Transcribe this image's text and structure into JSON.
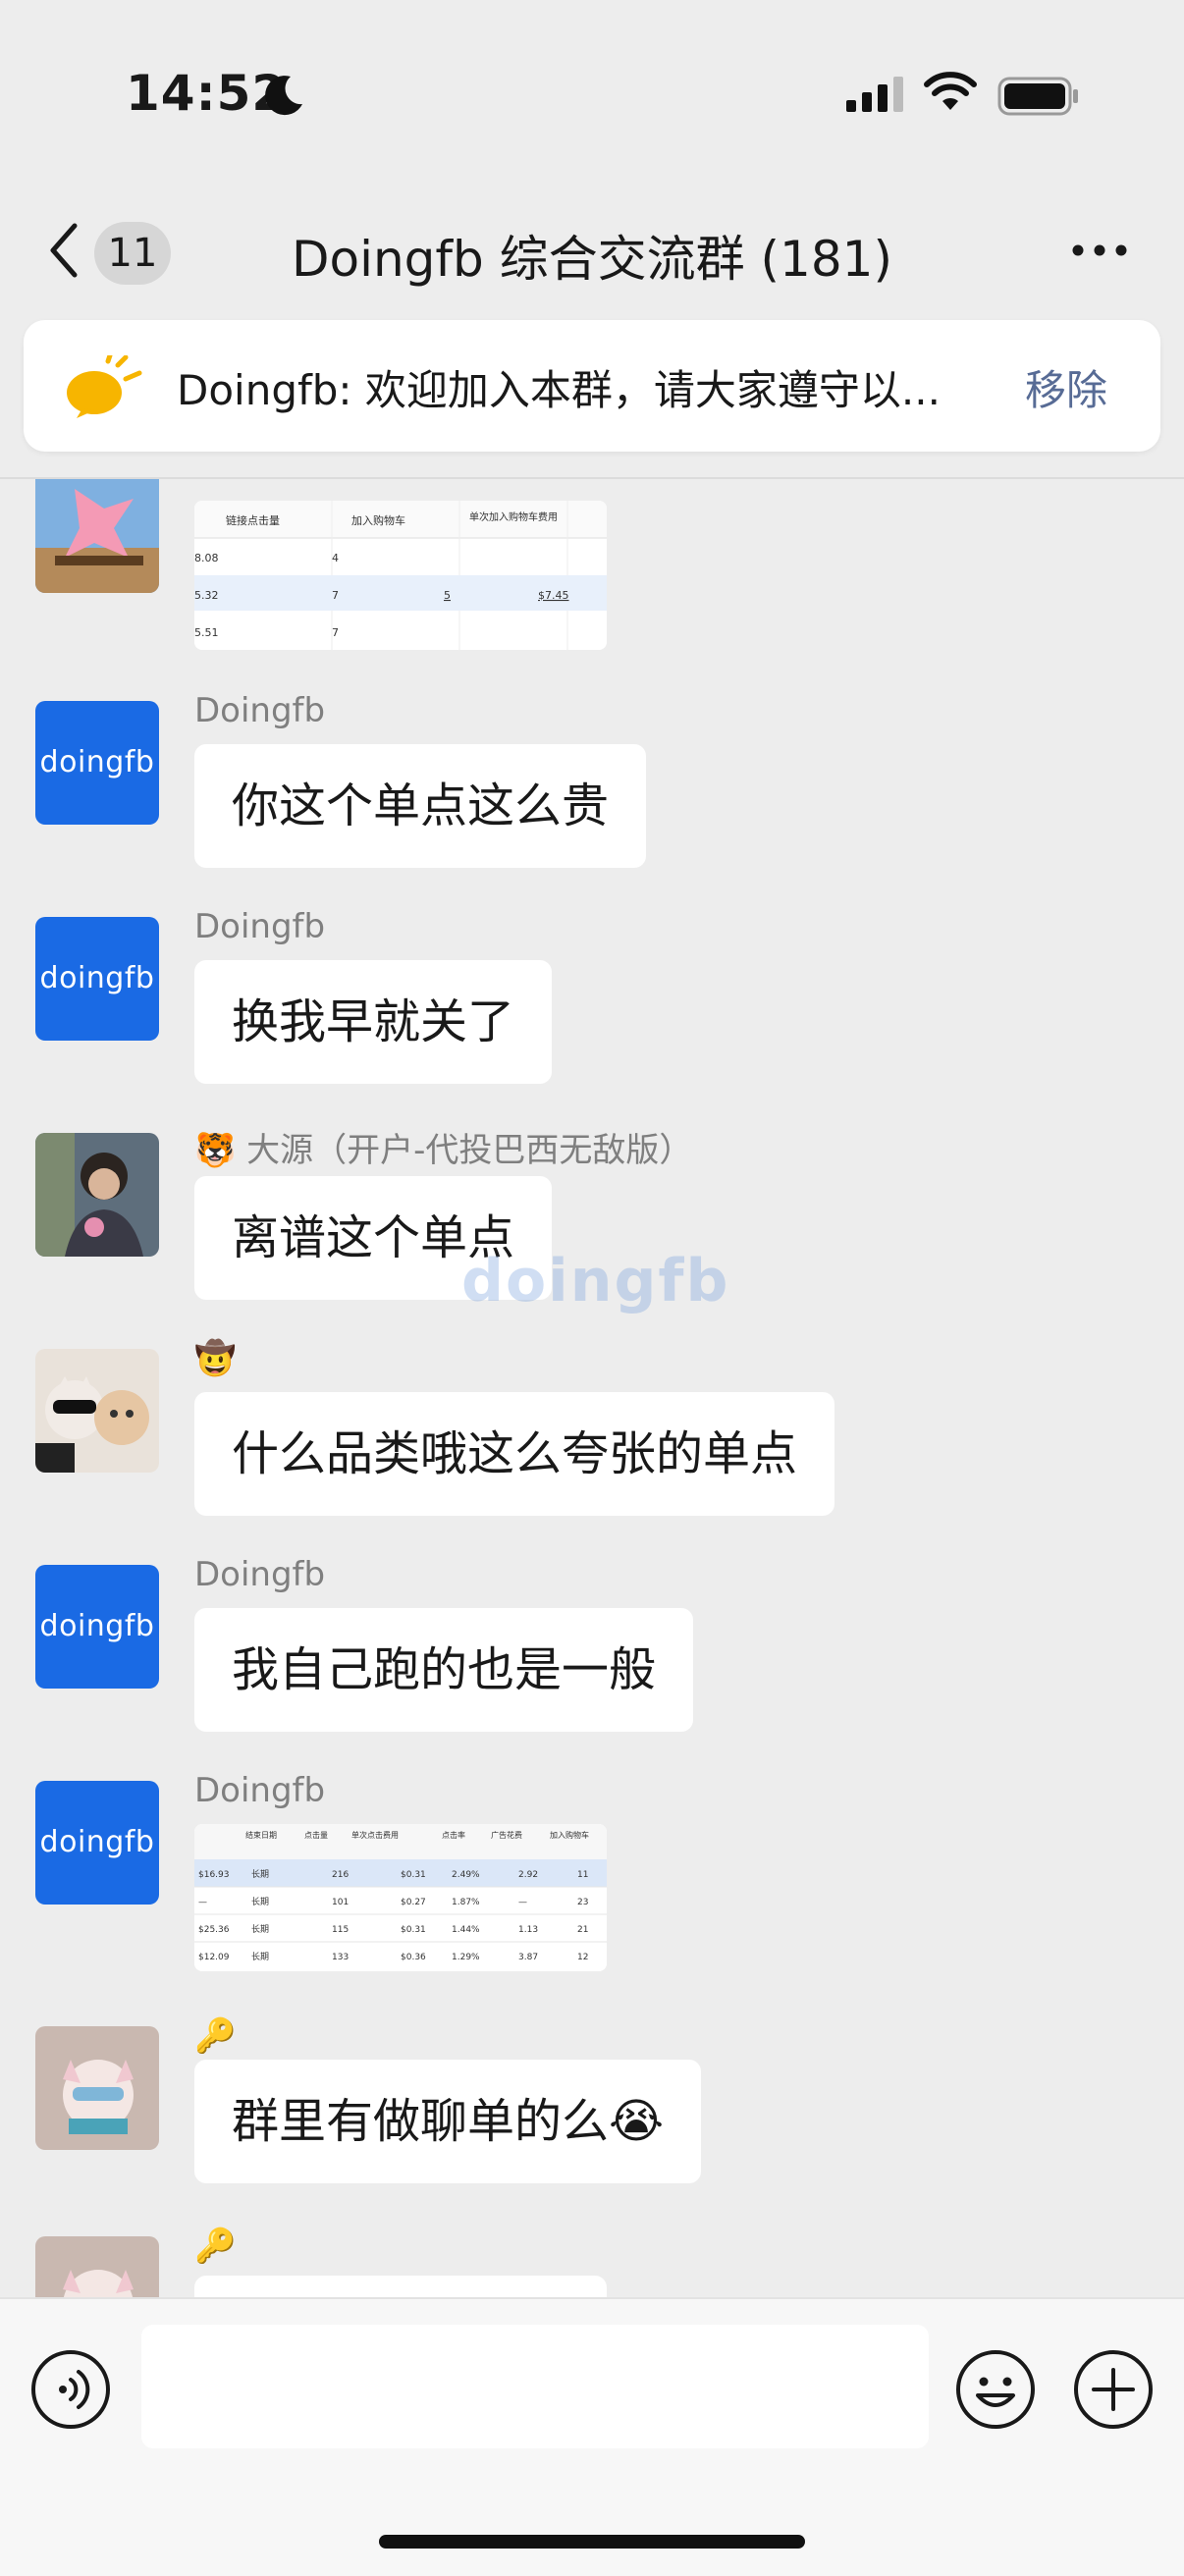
{
  "status_bar": {
    "time": "14:52"
  },
  "nav": {
    "back_count": "11",
    "title": "Doingfb 综合交流群 (181)"
  },
  "notice": {
    "text": "Doingfb: 欢迎加入本群，请大家遵守以...",
    "action": "移除"
  },
  "messages": [
    {
      "sender": "",
      "type": "image",
      "caption": "table-screenshot-1",
      "table1": {
        "headers": [
          "链接点击量",
          "加入购物车",
          "单次加入购物车费用"
        ],
        "rows": [
          [
            "8.08",
            "4",
            "—",
            "—"
          ],
          [
            "5.32",
            "7",
            "5",
            "$7.45"
          ],
          [
            "5.51",
            "7",
            "—",
            "—"
          ]
        ]
      }
    },
    {
      "sender": "Doingfb",
      "type": "text",
      "text": "你这个单点这么贵"
    },
    {
      "sender": "Doingfb",
      "type": "text",
      "text": "换我早就关了"
    },
    {
      "sender": "🐯 大源（开户-代投巴西无敌版）",
      "type": "text",
      "text": "离谱这个单点"
    },
    {
      "sender": "🤠",
      "type": "text",
      "text": "什么品类哦这么夸张的单点"
    },
    {
      "sender": "Doingfb",
      "type": "text",
      "text": "我自己跑的也是一般"
    },
    {
      "sender": "Doingfb",
      "type": "image",
      "table2": {
        "headers": [
          "结束日期",
          "点击量",
          "单次点击费用",
          "点击率",
          "广告花费",
          "加入购物车"
        ],
        "rows": [
          [
            "$16.93",
            "长期",
            "216",
            "$0.31",
            "2.49%",
            "2.92",
            "11"
          ],
          [
            "—",
            "长期",
            "101",
            "$0.27",
            "1.87%",
            "—",
            "23"
          ],
          [
            "$25.36",
            "长期",
            "115",
            "$0.31",
            "1.44%",
            "1.13",
            "21"
          ],
          [
            "$12.09",
            "长期",
            "133",
            "$0.36",
            "1.29%",
            "3.87",
            "12"
          ]
        ]
      }
    },
    {
      "sender": "🔑",
      "type": "text",
      "text": "群里有做聊单的么😭"
    },
    {
      "sender": "🔑",
      "type": "text",
      "text": ""
    }
  ],
  "watermark": "doingfb",
  "avatar_label": "doingfb",
  "colors": {
    "background": "#ededed",
    "bubble": "#ffffff",
    "brand": "#1a6ae4",
    "link": "#576b95"
  }
}
